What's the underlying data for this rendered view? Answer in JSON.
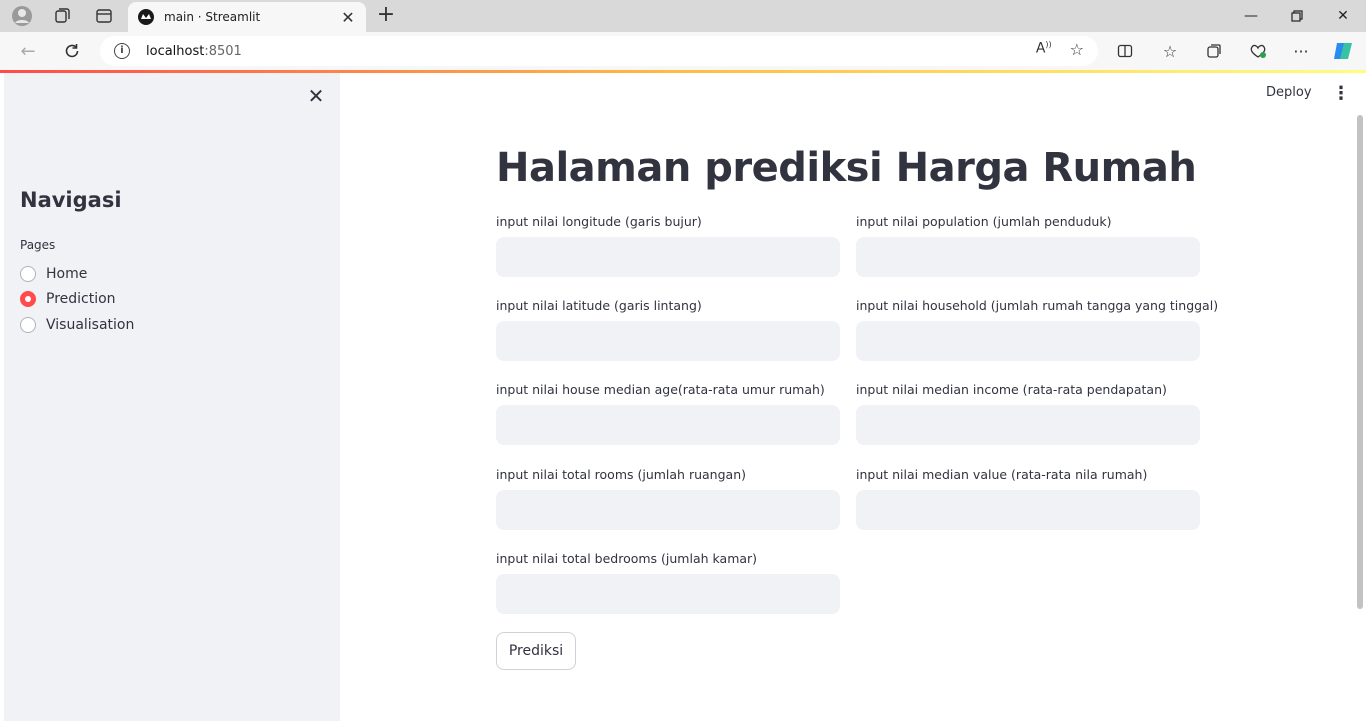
{
  "browser": {
    "tab_title": "main · Streamlit",
    "url_host": "localhost",
    "url_port": ":8501"
  },
  "sidebar": {
    "title": "Navigasi",
    "pages_label": "Pages",
    "pages": [
      {
        "label": "Home",
        "selected": false
      },
      {
        "label": "Prediction",
        "selected": true
      },
      {
        "label": "Visualisation",
        "selected": false
      }
    ]
  },
  "header": {
    "deploy_label": "Deploy"
  },
  "main": {
    "title": "Halaman prediksi Harga Rumah",
    "fields_left": [
      {
        "label": "input nilai longitude (garis bujur)",
        "value": ""
      },
      {
        "label": "input nilai latitude (garis lintang)",
        "value": ""
      },
      {
        "label": "input nilai house median age(rata-rata umur rumah)",
        "value": ""
      },
      {
        "label": "input nilai total rooms (jumlah ruangan)",
        "value": ""
      },
      {
        "label": "input nilai total bedrooms (jumlah kamar)",
        "value": ""
      }
    ],
    "fields_right": [
      {
        "label": "input nilai population (jumlah penduduk)",
        "value": ""
      },
      {
        "label": "input nilai household (jumlah rumah tangga yang tinggal)",
        "value": ""
      },
      {
        "label": "input nilai median income (rata-rata pendapatan)",
        "value": ""
      },
      {
        "label": "input nilai median value (rata-rata nila rumah)",
        "value": ""
      }
    ],
    "predict_label": "Prediksi"
  },
  "colors": {
    "accent": "#ff4b4b",
    "sidebar_bg": "#f0f2f6",
    "text": "#31333f"
  }
}
